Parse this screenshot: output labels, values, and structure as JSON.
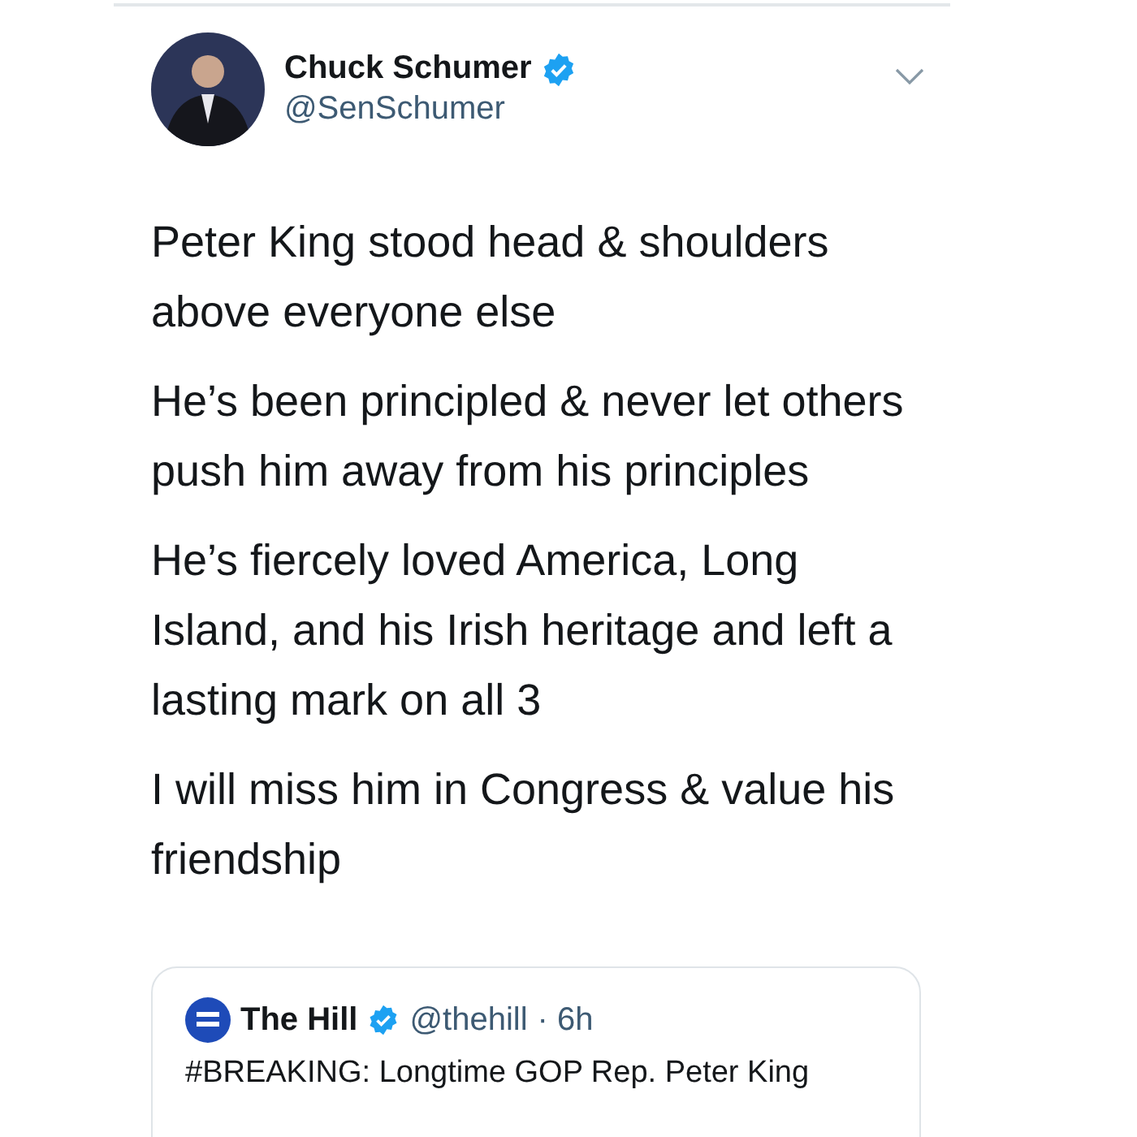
{
  "author": {
    "name": "Chuck Schumer",
    "handle": "@SenSchumer",
    "verified": true
  },
  "paragraphs": [
    "Peter King stood head & shoulders above everyone else",
    "He’s been principled & never let others push him away from his principles",
    "He’s fiercely loved America, Long Island, and his Irish heritage and left a lasting mark on all 3",
    "I will miss him in Congress & value his friendship"
  ],
  "quoted_tweet": {
    "name": "The Hill",
    "verified": true,
    "handle": "@thehill",
    "time": "· 6h",
    "text": "#BREAKING: Longtime GOP Rep. Peter King"
  }
}
